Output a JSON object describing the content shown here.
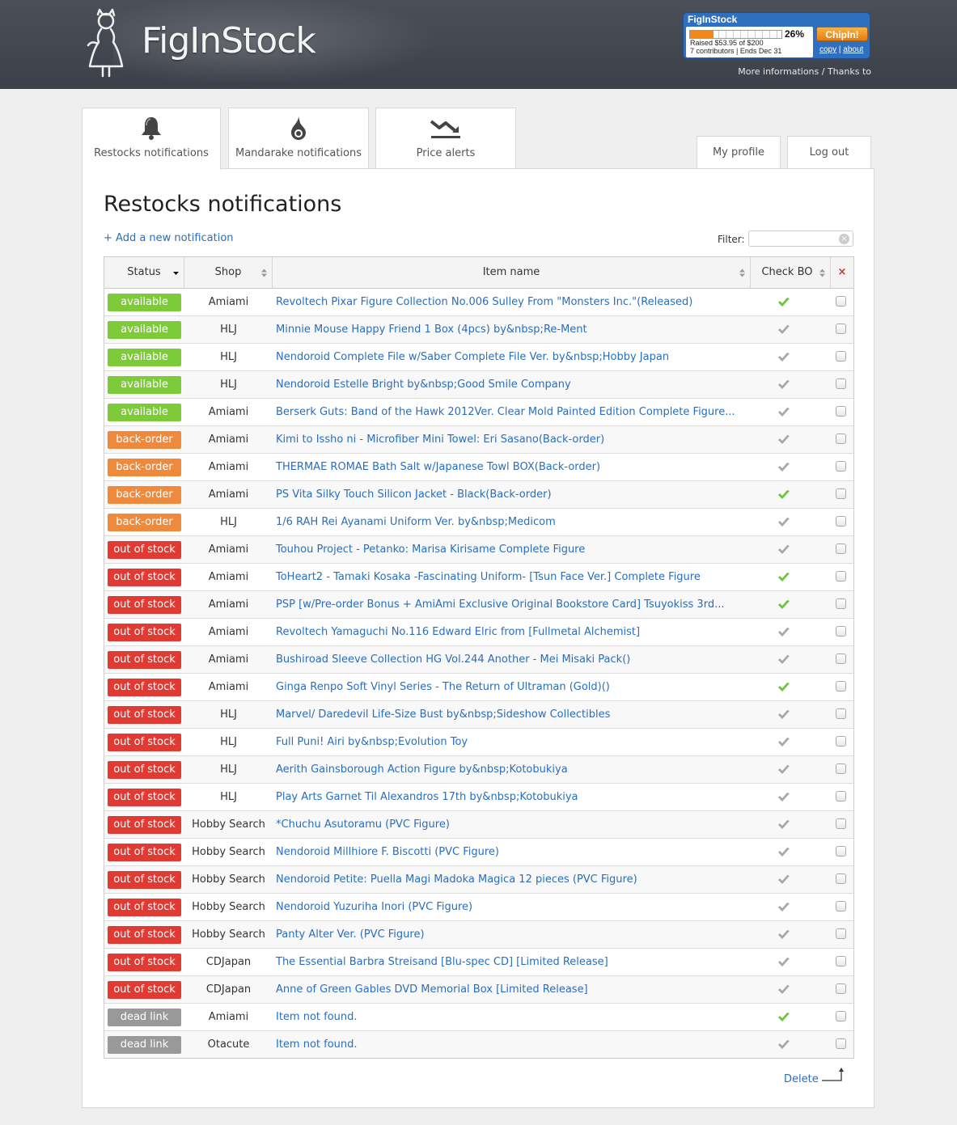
{
  "header": {
    "brand": "FigInStock",
    "more_info": "More informations / Thanks to"
  },
  "chipin": {
    "title": "FigInStock",
    "percent_label": "26%",
    "progress": 0.26,
    "raised": "Raised $53.95 of $200",
    "contributors": "7 contributors | Ends Dec 31",
    "button": "ChipIn!",
    "link_copy": "copy",
    "link_sep": "|",
    "link_about": "about"
  },
  "tabs": [
    {
      "label": "Restocks notifications",
      "icon": "bell-icon"
    },
    {
      "label": "Mandarake notifications",
      "icon": "drop-icon"
    },
    {
      "label": "Price alerts",
      "icon": "trend-down-icon"
    }
  ],
  "account": {
    "profile": "My profile",
    "logout": "Log out"
  },
  "main": {
    "title": "Restocks notifications",
    "add_link": "+ Add a new notification",
    "filter_label": "Filter:",
    "filter_value": "",
    "delete_label": "Delete"
  },
  "table": {
    "headers": {
      "status": "Status",
      "shop": "Shop",
      "item": "Item name",
      "check_bo": "Check BO",
      "remove": "×"
    },
    "rows": [
      {
        "status": "available",
        "shop": "Amiami",
        "item": "Revoltech Pixar Figure Collection No.006 Sulley From \"Monsters Inc.\"(Released)",
        "check_bo": true
      },
      {
        "status": "available",
        "shop": "HLJ",
        "item": "Minnie Mouse Happy Friend 1 Box (4pcs) by&nbsp;Re-Ment",
        "check_bo": false
      },
      {
        "status": "available",
        "shop": "HLJ",
        "item": "Nendoroid Complete File w/Saber Complete File Ver. by&nbsp;Hobby Japan",
        "check_bo": false
      },
      {
        "status": "available",
        "shop": "HLJ",
        "item": "Nendoroid Estelle Bright by&nbsp;Good Smile Company",
        "check_bo": false
      },
      {
        "status": "available",
        "shop": "Amiami",
        "item": "Berserk Guts: Band of the Hawk 2012Ver. Clear Mold Painted Edition Complete Figure...",
        "check_bo": false
      },
      {
        "status": "back-order",
        "shop": "Amiami",
        "item": "Kimi to Issho ni - Microfiber Mini Towel: Eri Sasano(Back-order)",
        "check_bo": false
      },
      {
        "status": "back-order",
        "shop": "Amiami",
        "item": "THERMAE ROMAE Bath Salt w/Japanese Towl BOX(Back-order)",
        "check_bo": false
      },
      {
        "status": "back-order",
        "shop": "Amiami",
        "item": "PS Vita Silky Touch Silicon Jacket - Black(Back-order)",
        "check_bo": true
      },
      {
        "status": "back-order",
        "shop": "HLJ",
        "item": "1/6 RAH Rei Ayanami Uniform Ver. by&nbsp;Medicom",
        "check_bo": false
      },
      {
        "status": "out of stock",
        "shop": "Amiami",
        "item": "Touhou Project - Petanko: Marisa Kirisame Complete Figure",
        "check_bo": false
      },
      {
        "status": "out of stock",
        "shop": "Amiami",
        "item": "ToHeart2 - Tamaki Kosaka -Fascinating Uniform- [Tsun Face Ver.] Complete Figure",
        "check_bo": true
      },
      {
        "status": "out of stock",
        "shop": "Amiami",
        "item": "PSP [w/Pre-order Bonus + AmiAmi Exclusive Original Bookstore Card] Tsuyokiss 3rd...",
        "check_bo": true
      },
      {
        "status": "out of stock",
        "shop": "Amiami",
        "item": "Revoltech Yamaguchi No.116 Edward Elric from [Fullmetal Alchemist]",
        "check_bo": false
      },
      {
        "status": "out of stock",
        "shop": "Amiami",
        "item": "Bushiroad Sleeve Collection HG Vol.244 Another - Mei Misaki Pack()",
        "check_bo": false
      },
      {
        "status": "out of stock",
        "shop": "Amiami",
        "item": "Ginga Renpo Soft Vinyl Series - The Return of Ultraman (Gold)()",
        "check_bo": true
      },
      {
        "status": "out of stock",
        "shop": "HLJ",
        "item": "Marvel/ Daredevil Life-Size Bust by&nbsp;Sideshow Collectibles",
        "check_bo": false
      },
      {
        "status": "out of stock",
        "shop": "HLJ",
        "item": "Full Puni! Airi by&nbsp;Evolution Toy",
        "check_bo": false
      },
      {
        "status": "out of stock",
        "shop": "HLJ",
        "item": "Aerith Gainsborough Action Figure by&nbsp;Kotobukiya",
        "check_bo": false
      },
      {
        "status": "out of stock",
        "shop": "HLJ",
        "item": "Play Arts Garnet Til Alexandros 17th by&nbsp;Kotobukiya",
        "check_bo": false
      },
      {
        "status": "out of stock",
        "shop": "Hobby Search",
        "item": "*Chuchu Asutoramu (PVC Figure)",
        "check_bo": false
      },
      {
        "status": "out of stock",
        "shop": "Hobby Search",
        "item": "Nendoroid Millhiore F. Biscotti (PVC Figure)",
        "check_bo": false
      },
      {
        "status": "out of stock",
        "shop": "Hobby Search",
        "item": "Nendoroid Petite: Puella Magi Madoka Magica 12 pieces (PVC Figure)",
        "check_bo": false
      },
      {
        "status": "out of stock",
        "shop": "Hobby Search",
        "item": "Nendoroid Yuzuriha Inori (PVC Figure)",
        "check_bo": false
      },
      {
        "status": "out of stock",
        "shop": "Hobby Search",
        "item": "Panty Alter Ver. (PVC Figure)",
        "check_bo": false
      },
      {
        "status": "out of stock",
        "shop": "CDJapan",
        "item": "The Essential Barbra Streisand [Blu-spec CD] [Limited Release]",
        "check_bo": false
      },
      {
        "status": "out of stock",
        "shop": "CDJapan",
        "item": "Anne of Green Gables DVD Memorial Box [Limited Release]",
        "check_bo": false
      },
      {
        "status": "dead link",
        "shop": "Amiami",
        "item": "Item not found.",
        "check_bo": true
      },
      {
        "status": "dead link",
        "shop": "Otacute",
        "item": "Item not found.",
        "check_bo": false
      }
    ]
  },
  "colors": {
    "available": "#7ecb3a",
    "back-order": "#ef8a3c",
    "out of stock": "#e03a32",
    "dead link": "#999999",
    "link": "#2a6ebb",
    "check_on": "#6cc63a",
    "check_off": "#a8a8a8"
  }
}
